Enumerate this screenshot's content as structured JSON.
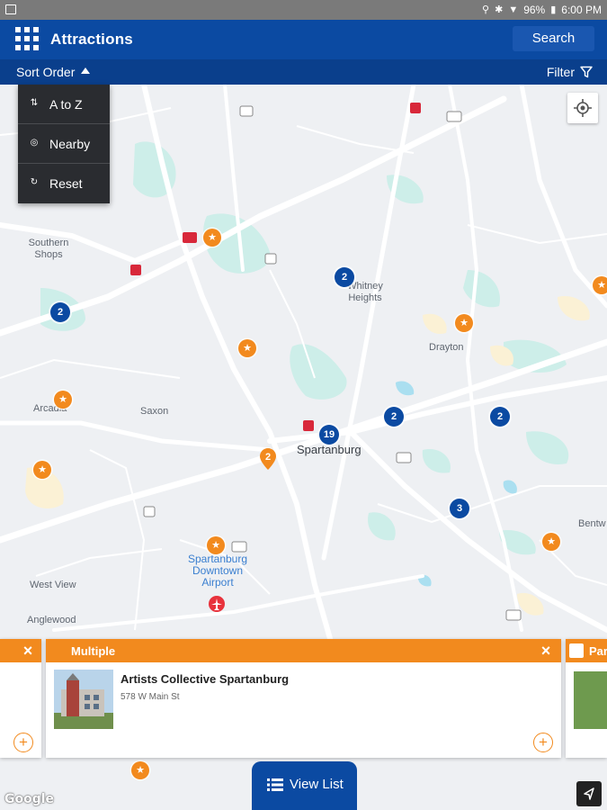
{
  "status_bar": {
    "battery": "96%",
    "time": "6:00 PM"
  },
  "app_bar": {
    "title": "Attractions",
    "search_label": "Search"
  },
  "sort_bar": {
    "sort_label": "Sort Order",
    "filter_label": "Filter"
  },
  "sort_menu": {
    "items": [
      {
        "label": "A to Z",
        "icon": "sort-az-icon"
      },
      {
        "label": "Nearby",
        "icon": "nearby-icon"
      },
      {
        "label": "Reset",
        "icon": "reset-icon"
      }
    ]
  },
  "map": {
    "labels": {
      "southern_shops": "Southern Shops",
      "whitney_heights": "Whitney Heights",
      "drayton": "Drayton",
      "arcadia": "Arcadia",
      "saxon": "Saxon",
      "spartanburg": "Spartanburg",
      "airport": "Spartanburg Downtown Airport",
      "west_view": "West View",
      "anglewood": "Anglewood",
      "bentwood": "Bentw"
    },
    "clusters": {
      "c1": "2",
      "c2": "2",
      "c3": "19",
      "c4": "2",
      "c5": "2",
      "c6": "3"
    },
    "pin_count": "2",
    "accent_color": "#0b4aa2",
    "poi_color": "#f28a1e"
  },
  "cards": {
    "main": {
      "header": "Multiple",
      "title": "Artists Collective Spartanburg",
      "address": "578 W Main St"
    },
    "next": {
      "header": "Par"
    }
  },
  "view_list_label": "View List",
  "attribution": "Google"
}
